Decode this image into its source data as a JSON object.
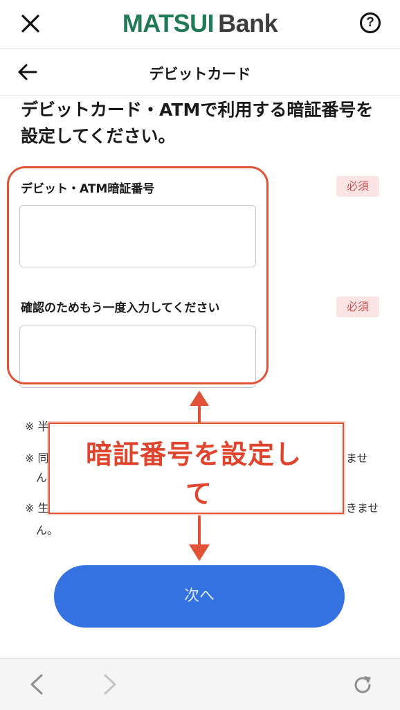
{
  "header": {
    "logo_brand": "MATSUI",
    "logo_suffix": "Bank",
    "help_symbol": "?",
    "close_icon": "close-icon",
    "help_icon": "help-circle-icon"
  },
  "subheader": {
    "title": "デビットカード",
    "back_icon": "arrow-left-icon"
  },
  "instruction": "デビットカード・ATMで利用する暗証番号を設定してください。",
  "fields": [
    {
      "label": "デビット・ATM暗証番号",
      "badge": "必須",
      "value": ""
    },
    {
      "label": "確認のためもう一度入力してください",
      "badge": "必須",
      "value": ""
    }
  ],
  "notes": [
    "※ 半",
    "※ 同",
    "ませ",
    "ん",
    "※ 生",
    "きませ",
    "ん。"
  ],
  "annotation": {
    "callout_line1": "暗証番号を設定し",
    "callout_line2": "て",
    "color": "#e0442c"
  },
  "next_button": {
    "label": "次へ",
    "color": "#3372e0"
  },
  "browser_nav": {
    "back_icon": "chevron-left-icon",
    "forward_icon": "chevron-right-icon",
    "reload_icon": "reload-icon"
  },
  "colors": {
    "brand_green": "#1f7a55",
    "badge_bg": "#fbe4e4",
    "badge_text": "#d05353"
  }
}
